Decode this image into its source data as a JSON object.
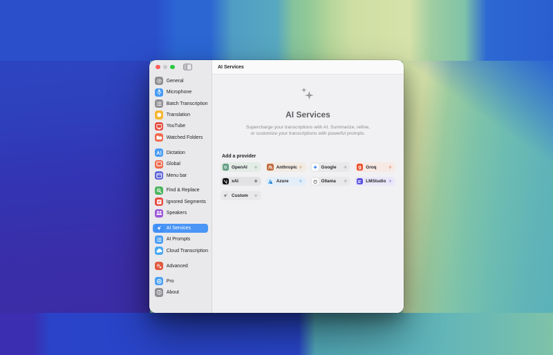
{
  "colors": {
    "selection_blue": "#4a95f6",
    "window_bg": "#f1f1f3",
    "sidebar_bg": "#e9e9ec",
    "wallpaper_palette": [
      "#2b4ecb",
      "#2a68d4",
      "#57a8c1",
      "#7fc3a8",
      "#cfe0a6",
      "#d6e2a9",
      "#3b2eb0",
      "#5cb2ba"
    ]
  },
  "window": {
    "controls": [
      {
        "name": "close",
        "color": "#ff5d57"
      },
      {
        "name": "minimize",
        "color": "#c9c9c9"
      },
      {
        "name": "zoom",
        "color": "#2bc840"
      }
    ],
    "sidebar": {
      "sections": [
        {
          "items": [
            {
              "label": "General",
              "icon": "gear",
              "color": "#8e8e93"
            },
            {
              "label": "Microphone",
              "icon": "microphone",
              "color": "#479bf5"
            },
            {
              "label": "Batch Transcription",
              "icon": "list",
              "color": "#8e8e93"
            },
            {
              "label": "Translation",
              "icon": "globe",
              "color": "#f5b731"
            },
            {
              "label": "YouTube",
              "icon": "monitor",
              "color": "#e8493c"
            },
            {
              "label": "Watched Folders",
              "icon": "folder",
              "color": "#ee6a4e"
            }
          ]
        },
        {
          "items": [
            {
              "label": "Dictation",
              "icon": "text-cursor",
              "color": "#479bf5"
            },
            {
              "label": "Global",
              "icon": "window-outline",
              "color": "#ee6a4e"
            },
            {
              "label": "Menu bar",
              "icon": "menubar",
              "color": "#5a60d8"
            }
          ]
        },
        {
          "items": [
            {
              "label": "Find & Replace",
              "icon": "magnifier",
              "color": "#4db45e"
            },
            {
              "label": "Ignored Segments",
              "icon": "document-lines",
              "color": "#e8493c"
            },
            {
              "label": "Speakers",
              "icon": "people",
              "color": "#9d57d8"
            }
          ]
        },
        {
          "items": [
            {
              "label": "AI Services",
              "icon": "sparkle",
              "color": "#3f8ef5",
              "selected": true
            },
            {
              "label": "AI Prompts",
              "icon": "list",
              "color": "#479bf5"
            },
            {
              "label": "Cloud Transcription",
              "icon": "cloud",
              "color": "#49a8f3"
            }
          ]
        },
        {
          "items": [
            {
              "label": "Advanced",
              "icon": "gears",
              "color": "#e05a3f"
            }
          ]
        },
        {
          "items": [
            {
              "label": "Pro",
              "icon": "target",
              "color": "#49a0f5"
            },
            {
              "label": "About",
              "icon": "info",
              "color": "#8e8e93"
            }
          ]
        }
      ]
    },
    "content": {
      "header_title": "AI Services",
      "hero": {
        "title": "AI Services",
        "description_line1": "Supercharge your transcriptions with AI. Summarize, refine,",
        "description_line2": "or customize your transcriptions with powerful prompts."
      },
      "add_provider_label": "Add a provider",
      "add_glyph": "+",
      "providers": [
        {
          "label": "OpenAI",
          "tint": "#e3ece6",
          "icon": "openai",
          "icon_bg": "#5f9a80",
          "plus_color": "#a3bfae"
        },
        {
          "label": "Anthropic",
          "tint": "#f2ebe3",
          "icon": "anthropic",
          "icon_bg": "#bf6c3f",
          "plus_color": "#d9b694"
        },
        {
          "label": "Google",
          "tint": "#e9e9eb",
          "icon": "gemini",
          "icon_bg": "#ffffff",
          "plus_color": "#b4b4b8"
        },
        {
          "label": "Groq",
          "tint": "#f7e9e4",
          "icon": "groq",
          "icon_bg": "#ea4e2e",
          "plus_color": "#e8a18c"
        },
        {
          "label": "xAI",
          "tint": "#e2e2e4",
          "icon": "xai",
          "icon_bg": "#0a0a0c",
          "plus_color": "#5e5e62"
        },
        {
          "label": "Azure",
          "tint": "#e4eef9",
          "icon": "azure",
          "icon_bg": "transparent",
          "plus_color": "#8fc0ec"
        },
        {
          "label": "Ollama",
          "tint": "#e9e9eb",
          "icon": "ollama",
          "icon_bg": "#ffffff",
          "plus_color": "#b4b4b8"
        },
        {
          "label": "LMStudio",
          "tint": "#eae7f9",
          "icon": "lmstudio",
          "icon_bg": "#5a50e0",
          "plus_color": "#ab9fe4"
        },
        {
          "label": "Custom",
          "tint": "#e9e9eb",
          "icon": "sparkle-dark",
          "icon_bg": "transparent",
          "plus_color": "#b4b4b8"
        }
      ]
    }
  }
}
